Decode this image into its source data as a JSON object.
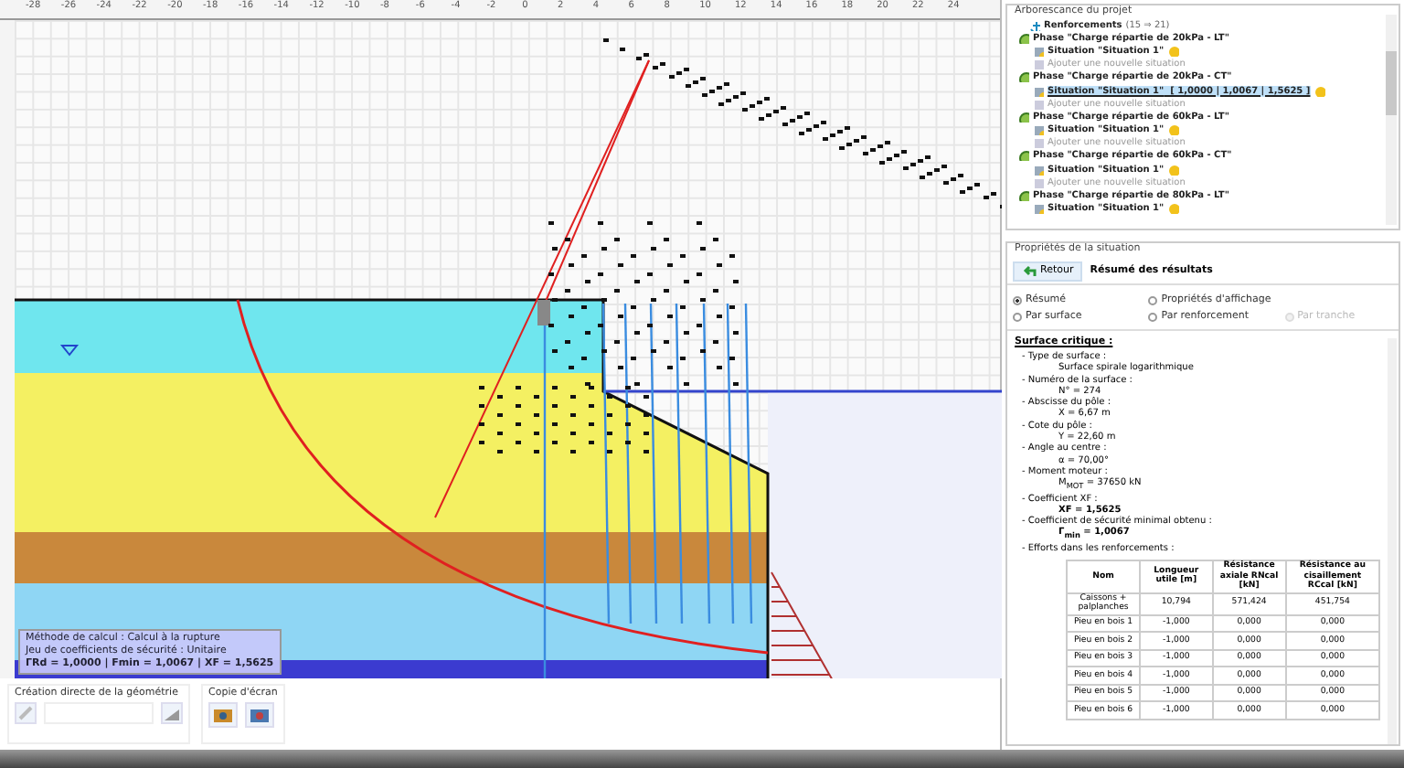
{
  "ruler": {
    "x_labels": [
      "-28",
      "-26",
      "-24",
      "-22",
      "-20",
      "-18",
      "-16",
      "-14",
      "-12",
      "-10",
      "-8",
      "-6",
      "-4",
      "-2",
      "0",
      "2",
      "4",
      "6",
      "8",
      "10",
      "12",
      "14",
      "16",
      "18",
      "20",
      "22",
      "24"
    ]
  },
  "info_box": {
    "lines": [
      "Méthode de calcul : Calcul à la rupture",
      "Jeu de coefficients de sécurité : Unitaire"
    ],
    "summary": "ΓRd = 1,0000 | Fmin = 1,0067 | XF = 1,5625"
  },
  "toolbar": {
    "geometry_group": "Création directe de la géométrie",
    "screenshot_group": "Copie d'écran"
  },
  "tree": {
    "title": "Arborescance du projet",
    "items": [
      {
        "kind": "reinforcements",
        "label": "Renforcements",
        "count": "(15 ⇒ 21)"
      },
      {
        "kind": "phase",
        "label": "Phase \"Charge répartie de 20kPa - LT\"",
        "children": [
          {
            "kind": "situation",
            "label": "Situation \"Situation 1\"",
            "selected": false
          },
          {
            "kind": "add",
            "label": "Ajouter une nouvelle situation"
          }
        ]
      },
      {
        "kind": "phase",
        "label": "Phase \"Charge répartie de 20kPa - CT\"",
        "children": [
          {
            "kind": "situation",
            "label": "Situation \"Situation 1\"",
            "result": "[ 1,0000 | 1,0067 | 1,5625 ]",
            "selected": true
          },
          {
            "kind": "add",
            "label": "Ajouter une nouvelle situation"
          }
        ]
      },
      {
        "kind": "phase",
        "label": "Phase \"Charge répartie de 60kPa - LT\"",
        "children": [
          {
            "kind": "situation",
            "label": "Situation \"Situation 1\"",
            "selected": false
          },
          {
            "kind": "add",
            "label": "Ajouter une nouvelle situation"
          }
        ]
      },
      {
        "kind": "phase",
        "label": "Phase \"Charge répartie de 60kPa - CT\"",
        "children": [
          {
            "kind": "situation",
            "label": "Situation \"Situation 1\"",
            "selected": false
          },
          {
            "kind": "add",
            "label": "Ajouter une nouvelle situation"
          }
        ]
      },
      {
        "kind": "phase",
        "label": "Phase \"Charge répartie de 80kPa - LT\"",
        "children": [
          {
            "kind": "situation",
            "label": "Situation \"Situation 1\"",
            "selected": false
          }
        ]
      }
    ]
  },
  "properties": {
    "title": "Propriétés de la situation",
    "back_button": "Retour",
    "heading": "Résumé des résultats",
    "options": [
      {
        "label": "Résumé",
        "selected": true,
        "disabled": false
      },
      {
        "label": "Propriétés d'affichage",
        "selected": false,
        "disabled": false
      },
      {
        "label": "Par surface",
        "selected": false,
        "disabled": false
      },
      {
        "label": "Par renforcement",
        "selected": false,
        "disabled": false
      },
      {
        "label": "Par tranche",
        "selected": false,
        "disabled": true
      }
    ],
    "report": {
      "title": "Surface critique :",
      "items": [
        {
          "label": "- Type de surface :",
          "value": "Surface spirale logarithmique",
          "emphasis": false
        },
        {
          "label": "- Numéro de la surface :",
          "value": "N° = 274",
          "emphasis": false
        },
        {
          "label": "- Abscisse du pôle :",
          "value": "X = 6,67 m",
          "emphasis": false
        },
        {
          "label": "- Cote du pôle :",
          "value": "Y = 22,60 m",
          "emphasis": false
        },
        {
          "label": "- Angle au centre :",
          "value": "α = 70,00°",
          "emphasis": false
        },
        {
          "label": "- Moment moteur :",
          "value": "M$_{MOT}$ = 37650 kN",
          "emphasis": false
        },
        {
          "label": "- Coefficient XF :",
          "value": "XF = 1,5625",
          "emphasis": true
        },
        {
          "label": "- Coefficient de sécurité minimal obtenu :",
          "value": "Γ$_{min}$ = 1,0067",
          "emphasis": true
        }
      ],
      "forces_label": "- Efforts dans les renforcements :",
      "table": {
        "columns": [
          "Nom",
          "Longueur utile [m]",
          "Résistance axiale RNcal [kN]",
          "Résistance au cisaillement RCcal [kN]"
        ],
        "rows": [
          [
            "Caissons + palplanches",
            "10,794",
            "571,424",
            "451,754"
          ],
          [
            "Pieu en bois 1",
            "-1,000",
            "0,000",
            "0,000"
          ],
          [
            "Pieu en bois 2",
            "-1,000",
            "0,000",
            "0,000"
          ],
          [
            "Pieu en bois 3",
            "-1,000",
            "0,000",
            "0,000"
          ],
          [
            "Pieu en bois 4",
            "-1,000",
            "0,000",
            "0,000"
          ],
          [
            "Pieu en bois 5",
            "-1,000",
            "0,000",
            "0,000"
          ],
          [
            "Pieu en bois 6",
            "-1,000",
            "0,000",
            "0,000"
          ]
        ]
      }
    }
  }
}
